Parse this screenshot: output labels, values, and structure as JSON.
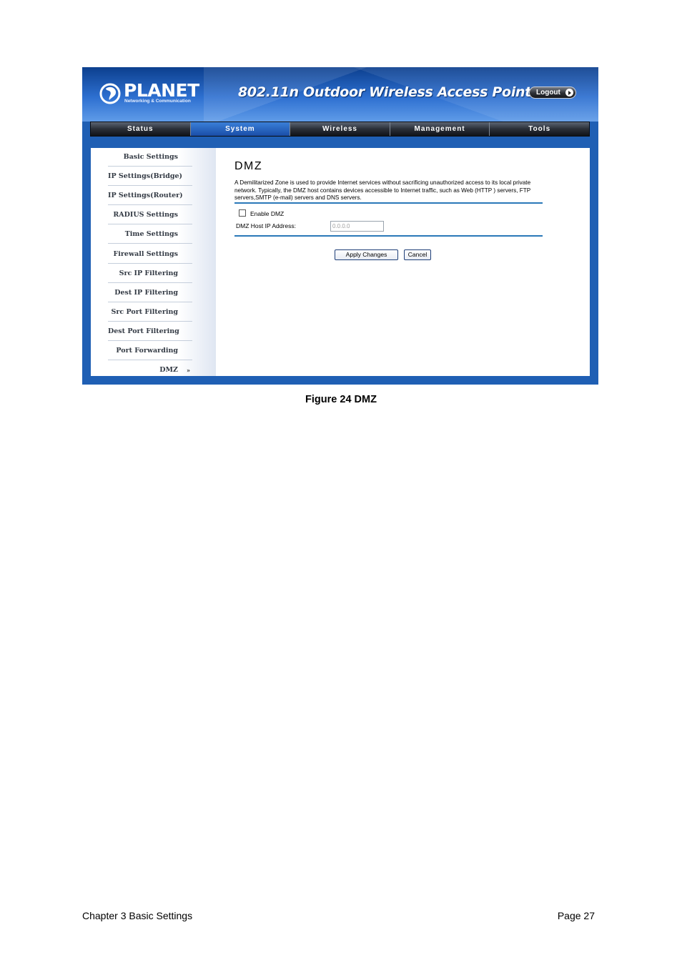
{
  "screenshot": {
    "logo": {
      "word": "PLANET",
      "tagline": "Networking & Communication"
    },
    "product_title": "802.11n Outdoor Wireless Access Point",
    "logout_label": "Logout",
    "nav": {
      "tabs": [
        {
          "label": "Status"
        },
        {
          "label": "System"
        },
        {
          "label": "Wireless"
        },
        {
          "label": "Management"
        },
        {
          "label": "Tools"
        }
      ],
      "active": "System"
    },
    "sidebar": {
      "items": [
        {
          "label": "Basic Settings"
        },
        {
          "label": "IP Settings(Bridge)"
        },
        {
          "label": "IP Settings(Router)"
        },
        {
          "label": "RADIUS Settings"
        },
        {
          "label": "Time Settings"
        },
        {
          "label": "Firewall Settings"
        },
        {
          "label": "Src IP Filtering"
        },
        {
          "label": "Dest IP Filtering"
        },
        {
          "label": "Src Port Filtering"
        },
        {
          "label": "Dest Port Filtering"
        },
        {
          "label": "Port Forwarding"
        },
        {
          "label": "DMZ"
        }
      ],
      "active": "DMZ",
      "active_marker": "»"
    },
    "main": {
      "title": "DMZ",
      "description": "A Demilitarized Zone is used to provide Internet services without sacrificing unauthorized access to its local private network. Typically, the DMZ host contains devices accessible to Internet traffic, such as Web (HTTP ) servers, FTP servers,SMTP (e-mail) servers and DNS servers.",
      "enable_label": "Enable DMZ",
      "enable_checked": false,
      "host_ip_label": "DMZ Host IP Address:",
      "host_ip_value": "0.0.0.0",
      "apply_label": "Apply Changes",
      "cancel_label": "Cancel"
    },
    "colors": {
      "frame": "#1f5fb4",
      "rule": "#2a78b8",
      "active_tab": "#1a4ea8"
    }
  },
  "caption": "Figure 24 DMZ",
  "footer": {
    "chapter": "Chapter 3 Basic Settings",
    "page": "Page 27"
  }
}
